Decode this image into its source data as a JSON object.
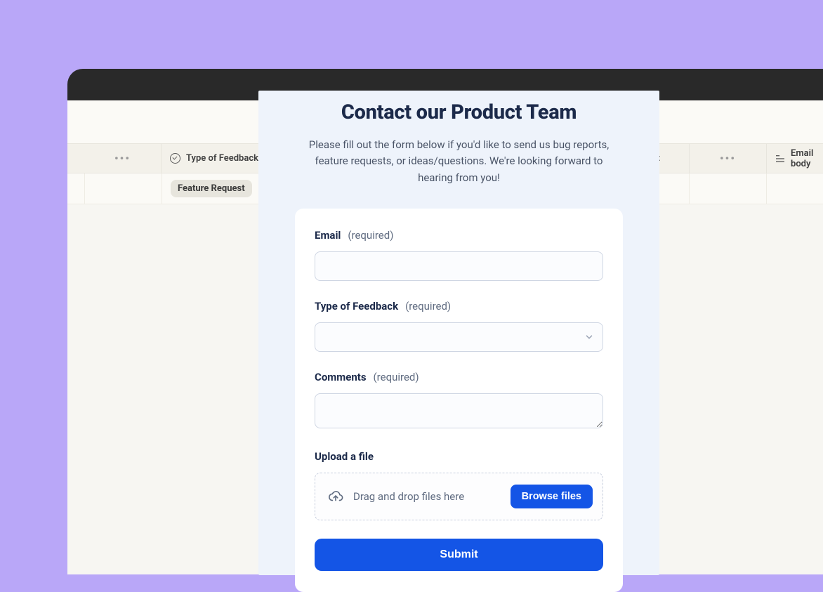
{
  "table": {
    "columns": {
      "type_of_feedback": "Type of Feedback",
      "subject_partial": "ubject",
      "email_body_partial": "Email body"
    },
    "row1": {
      "badge": "Feature Request"
    }
  },
  "form": {
    "title": "Contact our Product Team",
    "description": "Please fill out the form below if you'd like to send us bug reports, feature requests, or ideas/questions. We're looking forward to hearing from you!",
    "fields": {
      "email": {
        "label": "Email",
        "req": "(required)",
        "value": ""
      },
      "type": {
        "label": "Type of Feedback",
        "req": "(required)",
        "value": ""
      },
      "comments": {
        "label": "Comments",
        "req": "(required)",
        "value": ""
      },
      "upload": {
        "label": "Upload a file",
        "drop_text": "Drag and drop files here",
        "browse": "Browse files"
      }
    },
    "submit": "Submit"
  }
}
